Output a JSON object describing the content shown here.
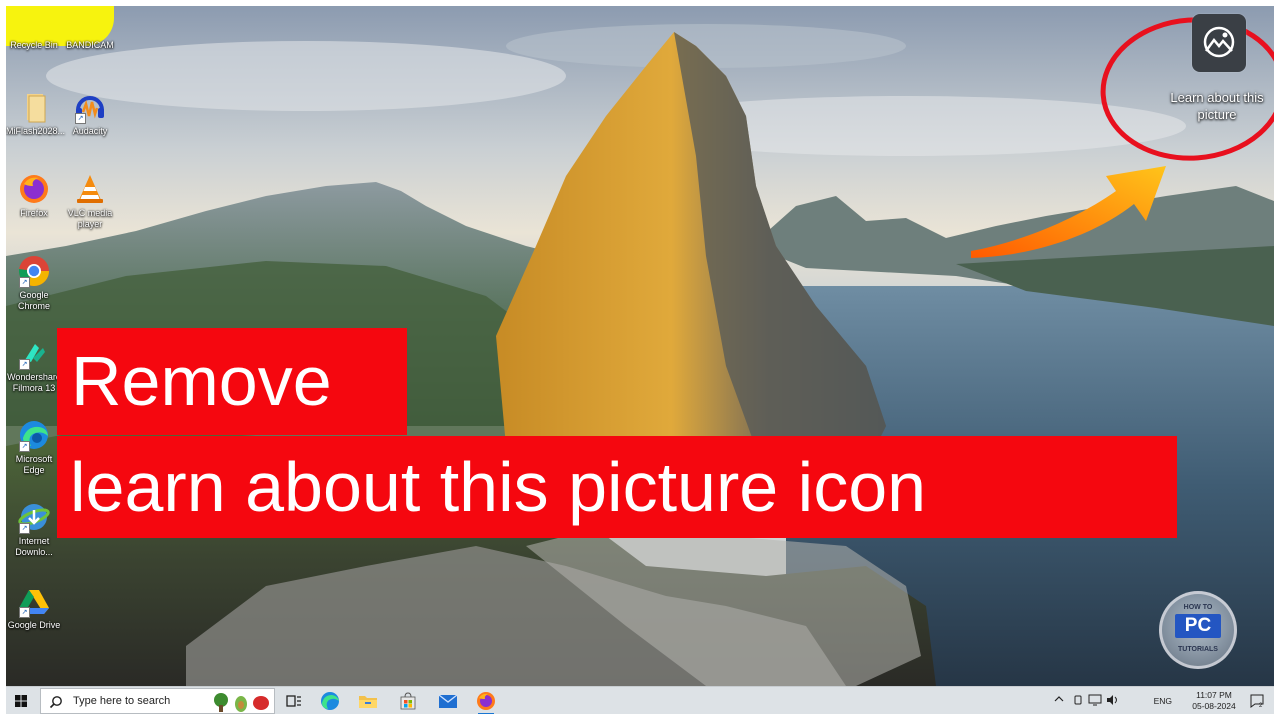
{
  "desktop": {
    "icons": [
      {
        "id": "recycle-bin",
        "label": "Recycle Bin"
      },
      {
        "id": "bandicam",
        "label": "BANDICAM"
      },
      {
        "id": "miflash",
        "label": "MiFlash2028..."
      },
      {
        "id": "audacity",
        "label": "Audacity"
      },
      {
        "id": "firefox",
        "label": "Firefox"
      },
      {
        "id": "vlc",
        "label": "VLC media player"
      },
      {
        "id": "chrome",
        "label": "Google Chrome"
      },
      {
        "id": "filmora",
        "label": "Wondershare Filmora 13"
      },
      {
        "id": "edge",
        "label": "Microsoft Edge"
      },
      {
        "id": "idm",
        "label": "Internet Downlo..."
      },
      {
        "id": "gdrive",
        "label": "Google Drive"
      }
    ],
    "learn_about": {
      "label": "Learn about this picture",
      "icon": "camera-pin-icon"
    }
  },
  "overlay": {
    "line1": "Remove",
    "line2": "learn about this picture icon",
    "highlight_color": "#f5070f",
    "ellipse_color": "#e8101e",
    "arrow_color": "#ff9a1a"
  },
  "watermark": {
    "top": "HOW TO",
    "mid": "PC",
    "bottom": "TUTORIALS"
  },
  "taskbar": {
    "search_placeholder": "Type here to search",
    "language": "ENG",
    "time": "11:07 PM",
    "date": "05-08-2024",
    "pinned": [
      "task-view",
      "edge",
      "file-explorer",
      "microsoft-store",
      "mail",
      "firefox"
    ]
  }
}
